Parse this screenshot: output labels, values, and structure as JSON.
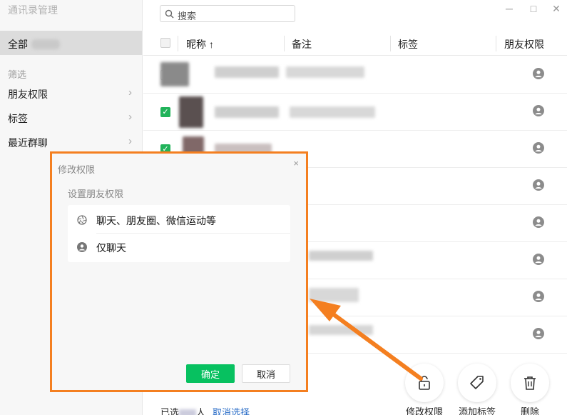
{
  "app": {
    "title": "通讯录管理"
  },
  "window_controls": {
    "minimize": "─",
    "maximize": "□",
    "close": "✕"
  },
  "sidebar": {
    "all_label": "全部",
    "filter_section": "筛选",
    "items": [
      {
        "label": "朋友权限",
        "chevron": "›"
      },
      {
        "label": "标签",
        "chevron": "›"
      },
      {
        "label": "最近群聊",
        "chevron": "›"
      }
    ]
  },
  "search": {
    "placeholder": "搜索"
  },
  "table": {
    "headers": {
      "nickname": "昵称 ↑",
      "remark": "备注",
      "tags": "标签",
      "permission": "朋友权限"
    },
    "rows": [
      {
        "checked": false,
        "permission_icon": "person-icon"
      },
      {
        "checked": true,
        "permission_icon": "person-icon"
      },
      {
        "checked": true,
        "permission_icon": "person-icon"
      },
      {
        "checked": false,
        "permission_icon": "person-icon"
      },
      {
        "checked": false,
        "permission_icon": "person-icon"
      },
      {
        "checked": false,
        "permission_icon": "person-icon"
      },
      {
        "checked": false,
        "permission_icon": "person-icon"
      },
      {
        "checked": false,
        "permission_icon": "person-icon"
      }
    ]
  },
  "dialog": {
    "title": "修改权限",
    "close": "×",
    "subtitle": "设置朋友权限",
    "options": [
      {
        "label": "聊天、朋友圈、微信运动等",
        "icon": "aperture-icon"
      },
      {
        "label": "仅聊天",
        "icon": "person-icon"
      }
    ],
    "confirm": "确定",
    "cancel": "取消"
  },
  "actions": [
    {
      "label": "修改权限",
      "icon": "lock-icon"
    },
    {
      "label": "添加标签",
      "icon": "tag-icon"
    },
    {
      "label": "删除",
      "icon": "trash-icon"
    }
  ],
  "footer": {
    "selected_prefix": "已选",
    "selected_suffix": "人",
    "cancel_selection": "取消选择"
  },
  "colors": {
    "accent_green": "#07c160",
    "highlight_orange": "#f47f20",
    "link_blue": "#2d6fc8"
  }
}
